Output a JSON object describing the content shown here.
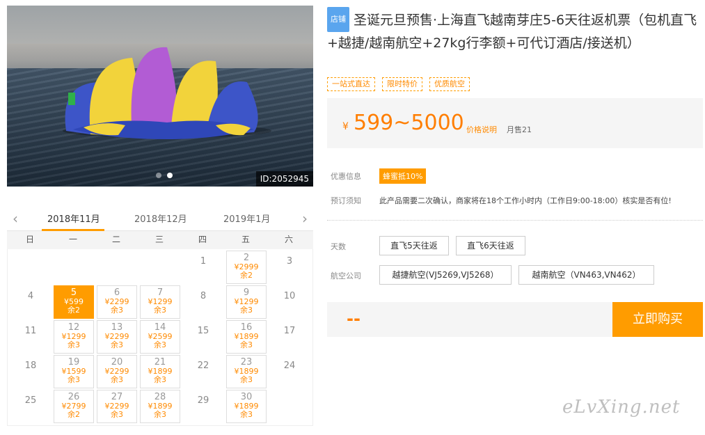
{
  "hero": {
    "id_tag": "ID:2052945"
  },
  "calendar": {
    "months": [
      "2018年11月",
      "2018年12月",
      "2019年1月"
    ],
    "weekdays": [
      "日",
      "一",
      "二",
      "三",
      "四",
      "五",
      "六"
    ]
  },
  "product": {
    "shop_tag": "店铺",
    "title": "圣诞元旦预售·上海直飞越南芽庄5-6天往返机票（包机直飞+越捷/越南航空+27kg行李额+可代订酒店/接送机）",
    "tags": [
      "一站式直达",
      "限时特价",
      "优质航空"
    ],
    "price_currency": "¥",
    "price_range": "599~5000",
    "price_explain": "价格说明",
    "monthly_sales": "月售21"
  },
  "offer": {
    "label": "优惠信息",
    "promo": "蜂蜜抵10%"
  },
  "booking": {
    "label": "预订须知",
    "text": "此产品需要二次确认，商家将在18个工作小时内（工作日9:00-18:00）核实是否有位!"
  },
  "days": {
    "label": "天数",
    "options": [
      "直飞5天往返",
      "直飞6天往返"
    ]
  },
  "airline": {
    "label": "航空公司",
    "options": [
      "越捷航空(VJ5269,VJ5268）",
      "越南航空（VN463,VN462）"
    ]
  },
  "buy": {
    "price_placeholder": "--",
    "button": "立即购买"
  },
  "watermark": "eLvXing.net"
}
